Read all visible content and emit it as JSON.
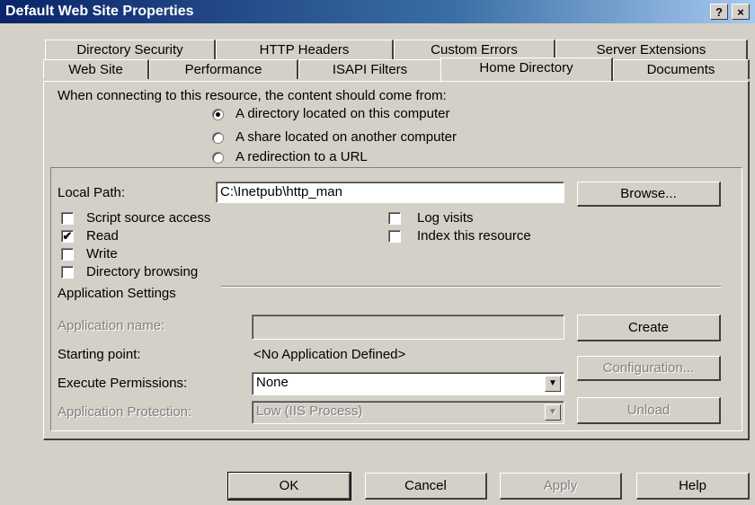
{
  "window": {
    "title": "Default Web Site Properties",
    "help_glyph": "?",
    "close_glyph": "×"
  },
  "tabs_row1": [
    "Directory Security",
    "HTTP Headers",
    "Custom Errors",
    "Server Extensions"
  ],
  "tabs_row2": [
    "Web Site",
    "Performance",
    "ISAPI Filters",
    "Home Directory",
    "Documents"
  ],
  "active_tab": "Home Directory",
  "source": {
    "prompt": "When connecting to this resource, the content should come from:",
    "options": [
      {
        "label": "A directory located on this computer",
        "selected": true
      },
      {
        "label": "A share located on another computer",
        "selected": false
      },
      {
        "label": "A redirection to a URL",
        "selected": false
      }
    ]
  },
  "local_path": {
    "label": "Local Path:",
    "value": "C:\\Inetpub\\http_man",
    "browse_label": "Browse..."
  },
  "checkboxes_left": [
    {
      "label": "Script source access",
      "checked": false
    },
    {
      "label": "Read",
      "checked": true
    },
    {
      "label": "Write",
      "checked": false
    },
    {
      "label": "Directory browsing",
      "checked": false
    }
  ],
  "checkboxes_right": [
    {
      "label": "Log visits",
      "checked": false
    },
    {
      "label": "Index this resource",
      "checked": false
    }
  ],
  "app_settings": {
    "heading": "Application Settings",
    "app_name_label": "Application name:",
    "app_name_value": "",
    "create_label": "Create",
    "starting_point_label": "Starting point:",
    "starting_point_value": "<No Application Defined>",
    "configuration_label": "Configuration...",
    "exec_perm_label": "Execute Permissions:",
    "exec_perm_value": "None",
    "app_protection_label": "Application Protection:",
    "app_protection_value": "Low (IIS Process)",
    "unload_label": "Unload"
  },
  "footer": {
    "ok": "OK",
    "cancel": "Cancel",
    "apply": "Apply",
    "help": "Help"
  },
  "icons": {
    "dropdown_arrow": "▼",
    "check_mark": "✔"
  }
}
